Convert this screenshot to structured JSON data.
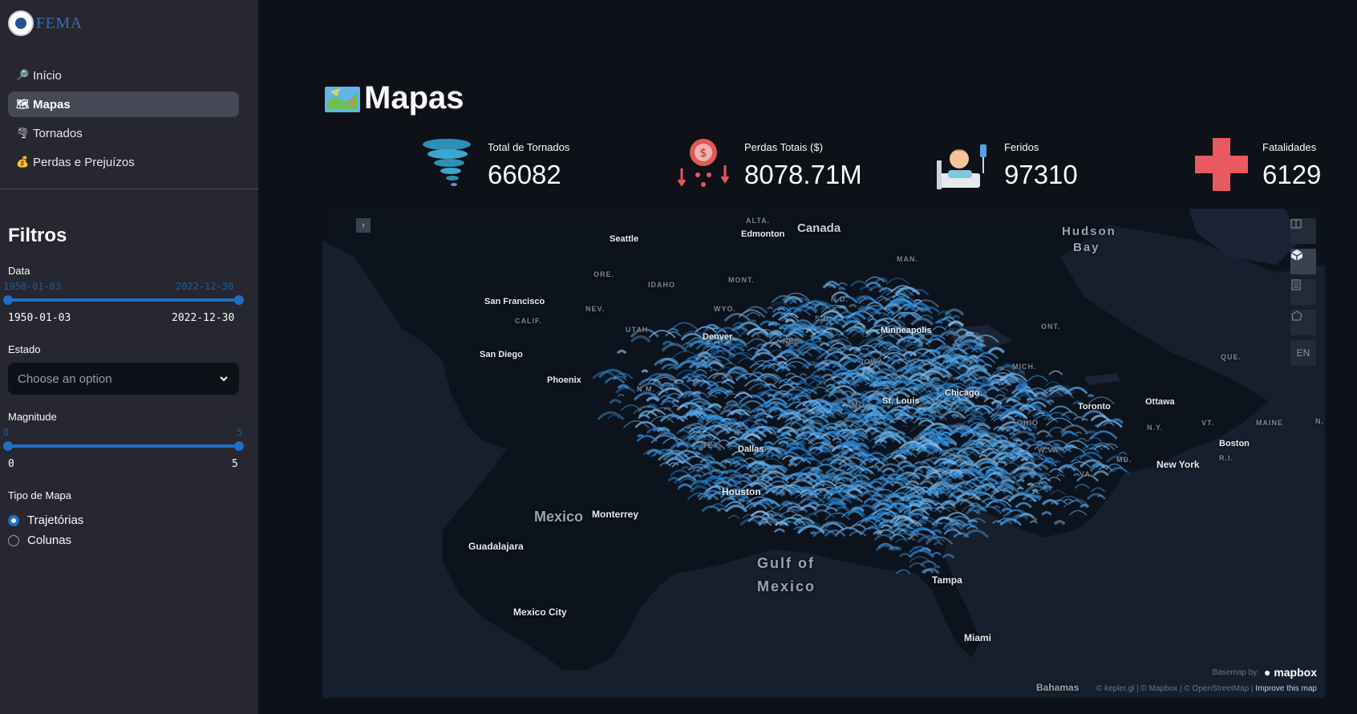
{
  "sidebar": {
    "logo_text": "FEMA",
    "nav": [
      {
        "label": "Início",
        "icon": "magnifier-icon"
      },
      {
        "label": "Mapas",
        "icon": "map-icon"
      },
      {
        "label": "Tornados",
        "icon": "tornado-icon"
      },
      {
        "label": "Perdas e Prejuízos",
        "icon": "money-bag-icon"
      }
    ],
    "filters": {
      "title": "Filtros",
      "data": {
        "label": "Data",
        "min": "1950-01-03",
        "max": "2022-12-30",
        "from": "1950-01-03",
        "to": "2022-12-30"
      },
      "estado": {
        "label": "Estado",
        "placeholder": "Choose an option"
      },
      "magnitude": {
        "label": "Magnitude",
        "min": "0",
        "max": "5",
        "from": "0",
        "to": "5"
      },
      "tipo_mapa": {
        "label": "Tipo de Mapa",
        "options": [
          "Trajetórias",
          "Colunas"
        ],
        "selected": "Trajetórias"
      }
    }
  },
  "main": {
    "title": "Mapas",
    "metrics": [
      {
        "label": "Total de Tornados",
        "value": "66082",
        "icon": "tornado-icon"
      },
      {
        "label": "Perdas Totais ($)",
        "value": "8078.71M",
        "icon": "money-loss-icon"
      },
      {
        "label": "Feridos",
        "value": "97310",
        "icon": "injured-person-icon"
      },
      {
        "label": "Fatalidades",
        "value": "6129",
        "icon": "red-cross-icon"
      }
    ],
    "map": {
      "labels": {
        "canada": "Canada",
        "hudson": "Hudson",
        "bay": "Bay",
        "seattle": "Seattle",
        "edmonton": "Edmonton",
        "alta": "ALTA.",
        "man": "MAN.",
        "ore": "ORE.",
        "idaho": "IDAHO",
        "mont": "MONT.",
        "nd": "N.D.",
        "sd": "S.D.",
        "sanfrancisco": "San Francisco",
        "nev": "NEV.",
        "wyo": "WYO.",
        "calif": "CALIF.",
        "utah": "UTAH",
        "denver": "Denver",
        "minneapolis": "Minneapolis",
        "ont": "ONT.",
        "que": "QUE.",
        "sandiego": "San Diego",
        "phoenix": "Phoenix",
        "nm": "N.M.",
        "mich": "MICH.",
        "stlouis": "St. Louis",
        "chicago": "Chicago",
        "toronto": "Toronto",
        "ottawa": "Ottawa",
        "ohio": "OHIO",
        "ny": "N.Y.",
        "vt": "VT.",
        "maine": "MAINE",
        "n": "N.",
        "tex": "TEX.",
        "dallas": "Dallas",
        "wva": "W.VA.",
        "boston": "Boston",
        "ri": "R.I.",
        "md": "MD.",
        "va": "VA.",
        "newyork": "New York",
        "houston": "Houston",
        "mexico": "Mexico",
        "monterrey": "Monterrey",
        "guadalajara": "Guadalajara",
        "gulf": "Gulf of",
        "gulf2": "Mexico",
        "tampa": "Tampa",
        "mexicocity": "Mexico City",
        "miami": "Miami",
        "bahamas": "Bahamas",
        "ne": "NEB.",
        "ia": "IOWA",
        "mo": "MO."
      },
      "toolbar": [
        "split-map-icon",
        "3d-cube-icon",
        "legend-icon",
        "draw-polygon-icon"
      ],
      "lang_button": "EN",
      "basemap_label": "Basemap by:",
      "basemap_brand": "mapbox",
      "attribution": "© kepler.gl | © Mapbox | © OpenStreetMap |",
      "improve": "Improve this map"
    }
  }
}
